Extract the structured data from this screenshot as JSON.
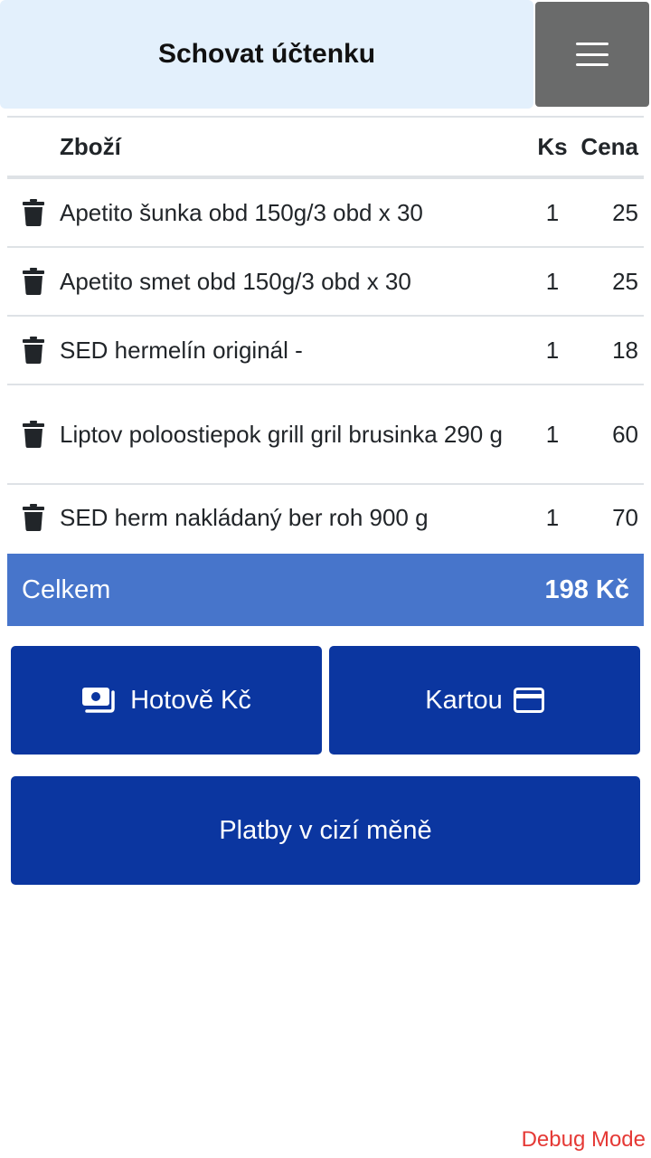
{
  "header": {
    "hide_receipt_label": "Schovat účtenku",
    "menu_icon": "hamburger-icon"
  },
  "table": {
    "headers": {
      "item": "Zboží",
      "qty": "Ks",
      "price": "Cena"
    },
    "rows": [
      {
        "name": "Apetito šunka obd 150g/3 obd x 30",
        "qty": "1",
        "price": "25"
      },
      {
        "name": "Apetito smet obd 150g/3 obd x 30",
        "qty": "1",
        "price": "25"
      },
      {
        "name": "SED hermelín originál -",
        "qty": "1",
        "price": "18"
      },
      {
        "name": "Liptov poloostiepok grill gril brusinka 290 g",
        "qty": "1",
        "price": "60"
      },
      {
        "name": "SED herm nakládaný ber roh 900 g",
        "qty": "1",
        "price": "70"
      }
    ],
    "delete_icon": "trash-icon"
  },
  "total": {
    "label": "Celkem",
    "amount": "198 Kč"
  },
  "payment": {
    "cash_label": "Hotově Kč",
    "cash_icon": "money-icon",
    "card_label": "Kartou",
    "card_icon": "credit-card-icon",
    "foreign_label": "Platby v cizí měně"
  },
  "footer": {
    "debug_label": "Debug Mode"
  },
  "colors": {
    "header_bg": "#e3f0fc",
    "menu_bg": "#6a6b6b",
    "total_bg": "#4775cb",
    "button_bg": "#0b36a0",
    "debug_text": "#e53935"
  }
}
